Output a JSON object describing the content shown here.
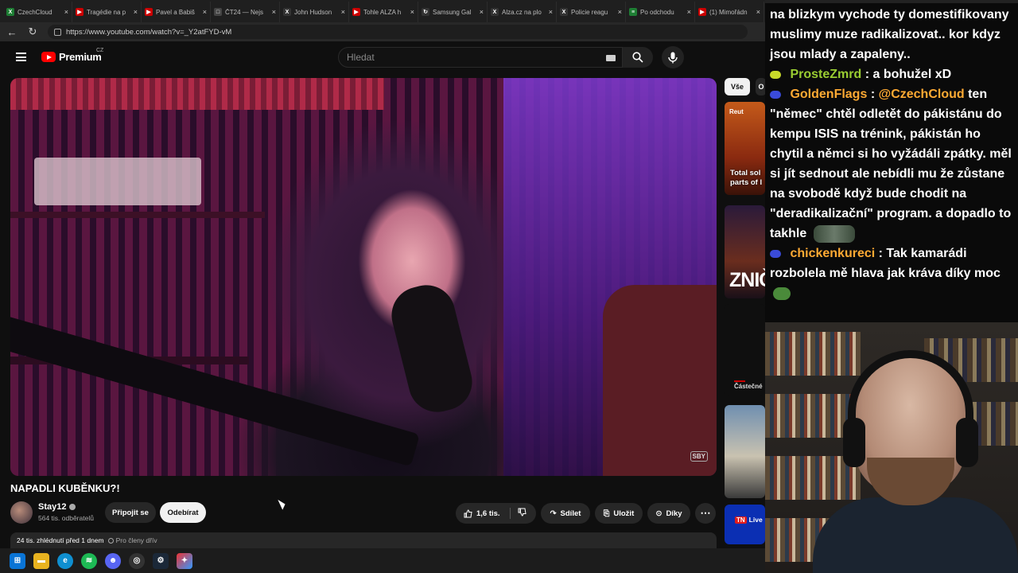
{
  "browser": {
    "tabs": [
      {
        "label": "CzechCloud",
        "color": "#1e7e34",
        "glyph": "X"
      },
      {
        "label": "Tragédie na p",
        "color": "#cc0000",
        "glyph": "▶"
      },
      {
        "label": "Pavel a Babiš",
        "color": "#cc0000",
        "glyph": "▶"
      },
      {
        "label": "ČT24 — Nejs",
        "color": "#444444",
        "glyph": "□"
      },
      {
        "label": "John Hudson",
        "color": "#333333",
        "glyph": "X"
      },
      {
        "label": "Tohle ALZA h",
        "color": "#cc0000",
        "glyph": "▶"
      },
      {
        "label": "Samsung Gal",
        "color": "#333333",
        "glyph": "↻"
      },
      {
        "label": "Alza.cz na plo",
        "color": "#333333",
        "glyph": "X"
      },
      {
        "label": "Policie reagu",
        "color": "#333333",
        "glyph": "X"
      },
      {
        "label": "Po odchodu",
        "color": "#1e7e34",
        "glyph": "≡"
      },
      {
        "label": "(1) Mimořádn",
        "color": "#cc0000",
        "glyph": "▶"
      }
    ],
    "url": "https://www.youtube.com/watch?v=_Y2atFYD-vM"
  },
  "header": {
    "logo": "Premium",
    "country": "CZ",
    "search_placeholder": "Hledat"
  },
  "video": {
    "watermark": "SBY",
    "title": "NAPADLI KUBĚNKU?!",
    "channel": "Stay12",
    "subscribers": "564 tis. odběratelů",
    "join_label": "Připojit se",
    "subscribe_label": "Odebírat",
    "likes": "1,6 tis.",
    "share_label": "Sdílet",
    "save_label": "Uložit",
    "thanks_label": "Díky",
    "views_date": "24 tis. zhlédnutí  před 1 dnem",
    "members_label": "Pro členy dřív"
  },
  "rail": {
    "chip_all": "Vše",
    "chip_2": "O",
    "thumb1_tag": "Reut",
    "thumb1_title": "Total sol parts of I",
    "thumb2_text": "ZNIČ",
    "thumb3_caption": "Částečné",
    "thumb5_live": "Live"
  },
  "chat": {
    "messages": [
      {
        "user": "",
        "user_color": "",
        "text": "na blizkym vychode ty domestifikovany muslimy muze radikalizovat.. kor kdyz jsou mlady a zapaleny..",
        "badge_color": "",
        "emote": ""
      },
      {
        "user": "ProsteZmrd",
        "user_color": "#9acd32",
        "text": ": a bohužel xD",
        "badge_color": "#c8d92a",
        "emote": ""
      },
      {
        "user": "GoldenFlags",
        "user_color": "#ffaa33",
        "mention": "@CzechCloud",
        "text": " ten \"němec\" chtěl odletět do pákistánu do kempu ISIS na trénink, pákistán ho chytil a němci si ho vyžádáli zpátky. měl si jít sednout ale nebídli mu že zůstane na svobodě když bude chodit na \"deradikalizační\" program. a dopadlo to takhle",
        "badge_color": "#3a4bd9",
        "emote": "cat"
      },
      {
        "user": "chickenkureci",
        "user_color": "#ffaa33",
        "text": ": Tak kamarádi rozbolela mě hlava jak kráva díky moc",
        "badge_color": "#3a4bd9",
        "emote": "pepe"
      }
    ]
  },
  "taskbar": {
    "icons": [
      "windows-icon",
      "folder-icon",
      "edge-icon",
      "spotify-icon",
      "discord-icon",
      "obs-icon",
      "steam-icon",
      "app-icon"
    ]
  }
}
